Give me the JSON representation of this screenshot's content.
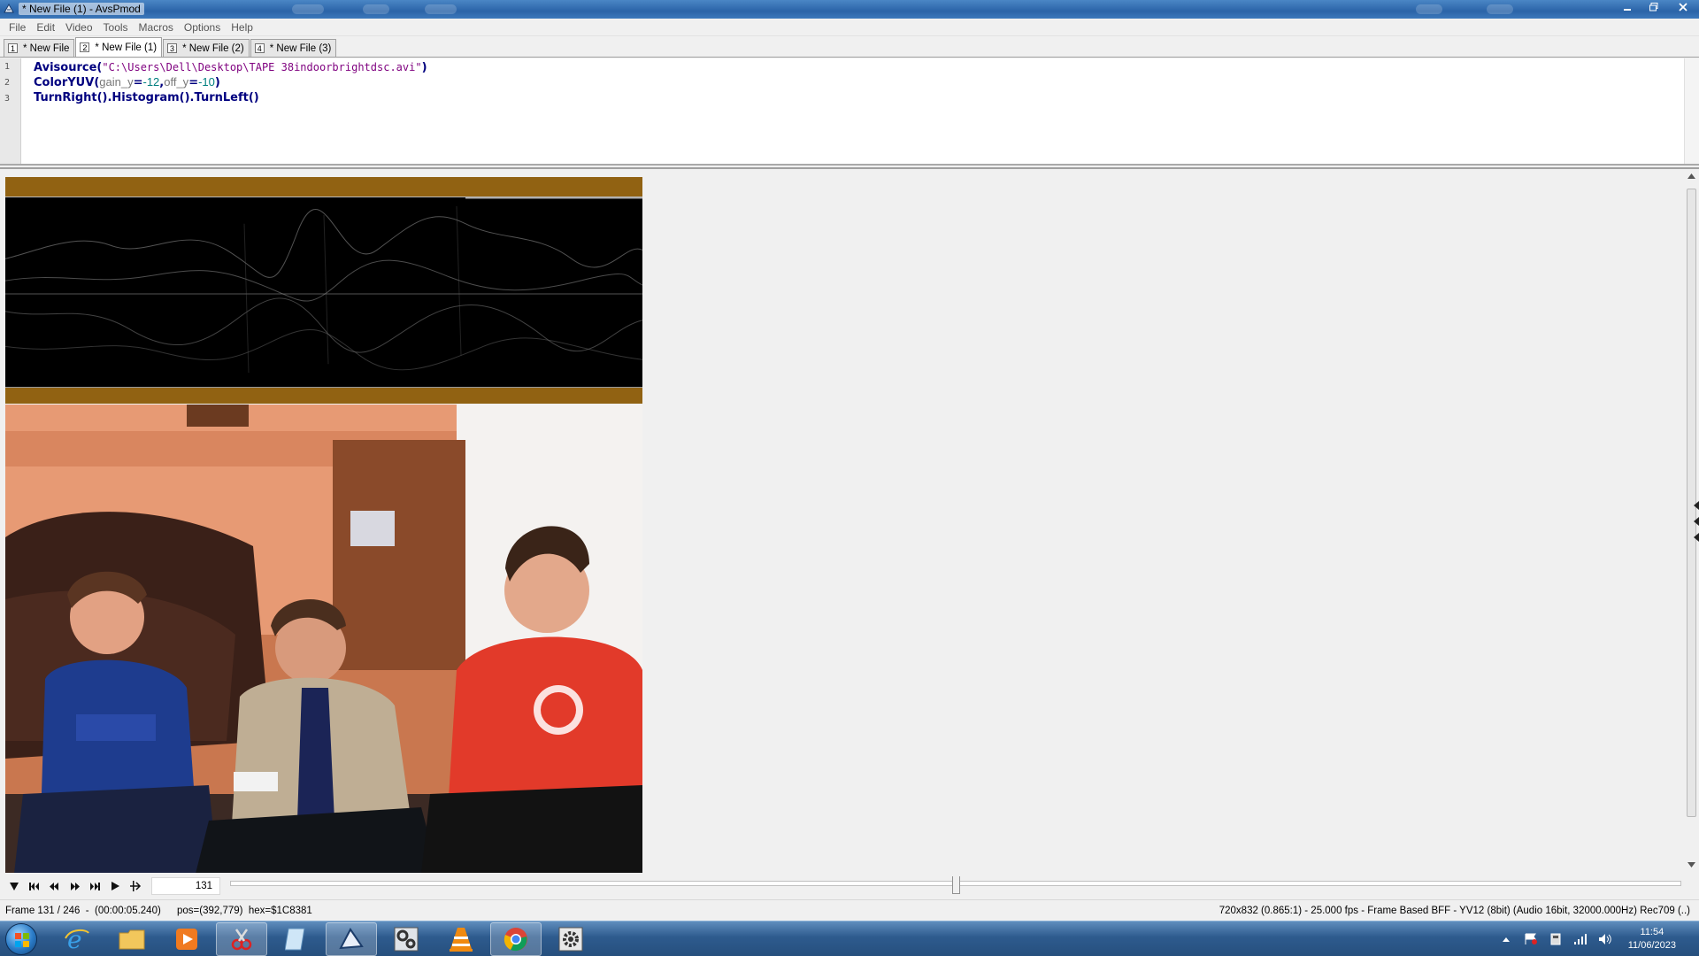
{
  "window": {
    "title": "* New File (1) - AvsPmod",
    "minimize_icon": "minimize-icon",
    "maximize_icon": "maximize-icon",
    "close_icon": "close-icon"
  },
  "menu": [
    "File",
    "Edit",
    "Video",
    "Tools",
    "Macros",
    "Options",
    "Help"
  ],
  "tabs": [
    {
      "num": "1",
      "label": "* New File"
    },
    {
      "num": "2",
      "label": "* New File (1)",
      "active": true
    },
    {
      "num": "3",
      "label": "* New File (2)"
    },
    {
      "num": "4",
      "label": "* New File (3)"
    }
  ],
  "editor": {
    "line_numbers": [
      "1",
      "2",
      "3"
    ],
    "line1": {
      "fn": "Avisource",
      "open": "(",
      "str": "\"C:\\Users\\Dell\\Desktop\\TAPE 38indoorbrightdsc.avi\"",
      "close": ")"
    },
    "line2": {
      "fn": "ColorYUV",
      "open": "(",
      "arg1": "gain_y",
      "eq1": "=",
      "val1": "-12",
      "comma": ",",
      "arg2": "off_y",
      "eq2": "=",
      "val2": "-10",
      "close": ")"
    },
    "line3": {
      "code": "TurnRight().Histogram().TurnLeft()"
    }
  },
  "playback": {
    "frame_value": "131",
    "slider_position": 0.5
  },
  "status": {
    "frame": "Frame 131 / 246  -  (00:00:05.240)",
    "pos": "pos=(392,779)  hex=$1C8381",
    "info": "720x832 (0.865:1) - 25.000 fps - Frame Based BFF - YV12 (8bit) (Audio 16bit, 32000.000Hz) Rec709 (..)"
  },
  "taskbar": {
    "apps": [
      "internet-explorer-icon",
      "file-explorer-icon",
      "media-player-icon",
      "snipping-tool-icon",
      "notepad-icon",
      "avspmod-icon",
      "settings-app-icon",
      "vlc-icon",
      "chrome-icon",
      "gear-app-icon"
    ],
    "clock_time": "11:54",
    "clock_date": "11/06/2023"
  },
  "colors": {
    "histogram_border": "#916212",
    "taskbar": "#2e5b8e",
    "code_function": "#00007f",
    "code_string": "#7f007f",
    "code_number": "#007f7f"
  }
}
